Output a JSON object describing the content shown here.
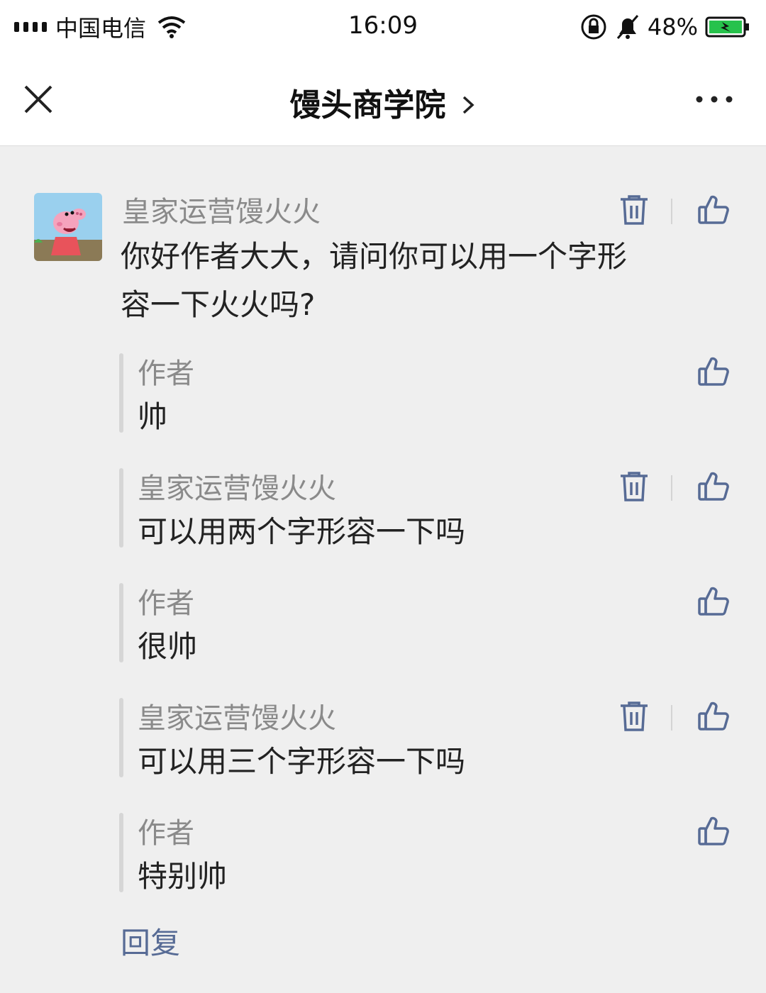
{
  "status_bar": {
    "carrier": "中国电信",
    "time": "16:09",
    "battery": "48%"
  },
  "nav": {
    "title": "馒头商学院"
  },
  "comment": {
    "author": "皇家运营馒火火",
    "text_line1": "你好作者大大，请问你可以用一个字形",
    "text_line2": "容一下火火吗?",
    "replies": [
      {
        "author": "作者",
        "text": "帅"
      },
      {
        "author": "皇家运营馒火火",
        "text": "可以用两个字形容一下吗"
      },
      {
        "author": "作者",
        "text": "很帅"
      },
      {
        "author": "皇家运营馒火火",
        "text": "可以用三个字形容一下吗"
      },
      {
        "author": "作者",
        "text": "特别帅"
      }
    ],
    "reply_link": "回复"
  },
  "icons": {
    "accent": "#576b95",
    "delete": "trash-icon",
    "like": "thumbs-up-icon"
  }
}
